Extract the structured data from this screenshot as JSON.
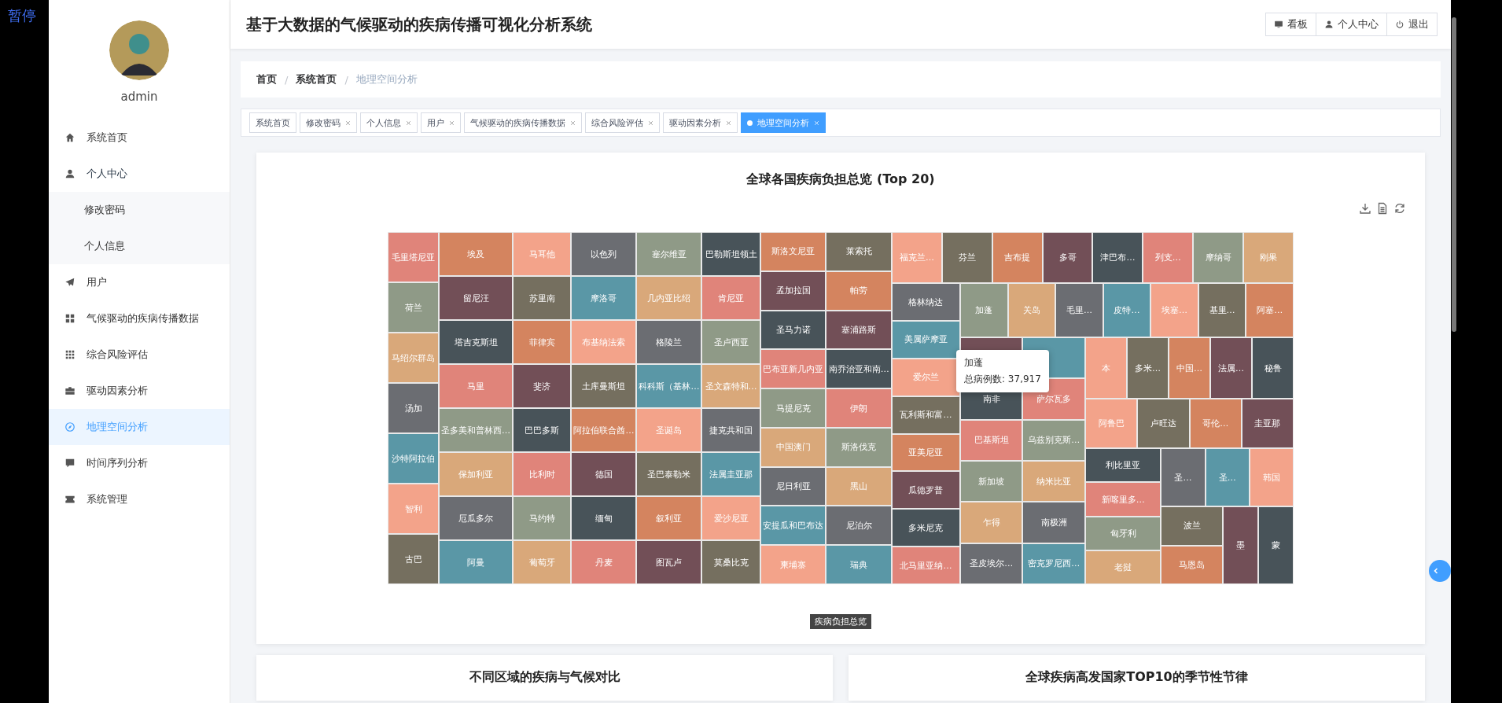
{
  "overlay": {
    "label": "暂停"
  },
  "sidebar": {
    "user": {
      "name": "admin"
    },
    "items": [
      {
        "label": "系统首页",
        "selected": false
      },
      {
        "label": "个人中心",
        "selected": false,
        "expanded": true,
        "children": [
          {
            "label": "修改密码",
            "selected": false
          },
          {
            "label": "个人信息",
            "selected": false
          }
        ]
      },
      {
        "label": "用户",
        "selected": false
      },
      {
        "label": "气候驱动的疾病传播数据",
        "selected": false
      },
      {
        "label": "综合风险评估",
        "selected": false
      },
      {
        "label": "驱动因素分析",
        "selected": false
      },
      {
        "label": "地理空间分析",
        "selected": true
      },
      {
        "label": "时间序列分析",
        "selected": false
      },
      {
        "label": "系统管理",
        "selected": false
      }
    ]
  },
  "header": {
    "title": "基于大数据的气候驱动的疾病传播可视化分析系统",
    "buttons": [
      {
        "label": "看板"
      },
      {
        "label": "个人中心"
      },
      {
        "label": "退出"
      }
    ]
  },
  "breadcrumb": {
    "separator": "/",
    "items": [
      {
        "label": "首页",
        "current": false
      },
      {
        "label": "系统首页",
        "current": false
      },
      {
        "label": "地理空间分析",
        "current": true
      }
    ]
  },
  "tabs": [
    {
      "label": "系统首页",
      "closable": false,
      "selected": false
    },
    {
      "label": "修改密码",
      "closable": true,
      "selected": false
    },
    {
      "label": "个人信息",
      "closable": true,
      "selected": false
    },
    {
      "label": "用户",
      "closable": true,
      "selected": false
    },
    {
      "label": "气候驱动的疾病传播数据",
      "closable": true,
      "selected": false
    },
    {
      "label": "综合风险评估",
      "closable": true,
      "selected": false
    },
    {
      "label": "驱动因素分析",
      "closable": true,
      "selected": false
    },
    {
      "label": "地理空间分析",
      "closable": true,
      "selected": true
    }
  ],
  "chart_card": {
    "title": "全球各国疾病负担总览 (Top 20)",
    "legend": "疾病负担总览",
    "tooltip": {
      "name": "加蓬",
      "text": "总病例数: 37,917"
    },
    "treemap": {
      "kind": "row",
      "children": [
        {
          "kind": "column",
          "children": [
            {
              "kind": "tile",
              "label": "毛里塔尼亚",
              "color": "#e0847a"
            },
            {
              "kind": "tile",
              "label": "荷兰",
              "color": "#8f9a87"
            },
            {
              "kind": "tile",
              "label": "马绍尔群岛",
              "color": "#d9a87a"
            },
            {
              "kind": "tile",
              "label": "汤加",
              "color": "#6b6d72"
            },
            {
              "kind": "tile",
              "label": "沙特阿拉伯",
              "color": "#5a97a6"
            },
            {
              "kind": "tile",
              "label": "智利",
              "color": "#f3a38a"
            },
            {
              "kind": "tile",
              "label": "古巴",
              "color": "#756f5f"
            }
          ]
        },
        {
          "kind": "column",
          "children": [
            {
              "kind": "tile",
              "label": "埃及",
              "color": "#d4845f"
            },
            {
              "kind": "tile",
              "label": "留尼汪",
              "color": "#724f57"
            },
            {
              "kind": "tile",
              "label": "塔吉克斯坦",
              "color": "#485359"
            },
            {
              "kind": "tile",
              "label": "马里",
              "color": "#e0847a"
            },
            {
              "kind": "tile",
              "label": "圣多美和普林西…",
              "color": "#8f9a87"
            },
            {
              "kind": "tile",
              "label": "保加利亚",
              "color": "#d9a87a"
            },
            {
              "kind": "tile",
              "label": "厄瓜多尔",
              "color": "#6b6d72"
            },
            {
              "kind": "tile",
              "label": "阿曼",
              "color": "#5a97a6"
            }
          ]
        },
        {
          "kind": "column",
          "children": [
            {
              "kind": "tile",
              "label": "马耳他",
              "color": "#f3a38a"
            },
            {
              "kind": "tile",
              "label": "苏里南",
              "color": "#756f5f"
            },
            {
              "kind": "tile",
              "label": "菲律宾",
              "color": "#d4845f"
            },
            {
              "kind": "tile",
              "label": "斐济",
              "color": "#724f57"
            },
            {
              "kind": "tile",
              "label": "巴巴多斯",
              "color": "#485359"
            },
            {
              "kind": "tile",
              "label": "比利时",
              "color": "#e0847a"
            },
            {
              "kind": "tile",
              "label": "马约特",
              "color": "#8f9a87"
            },
            {
              "kind": "tile",
              "label": "葡萄牙",
              "color": "#d9a87a"
            }
          ]
        },
        {
          "kind": "column",
          "children": [
            {
              "kind": "tile",
              "label": "以色列",
              "color": "#6b6d72"
            },
            {
              "kind": "tile",
              "label": "摩洛哥",
              "color": "#5a97a6"
            },
            {
              "kind": "tile",
              "label": "布基纳法索",
              "color": "#f3a38a"
            },
            {
              "kind": "tile",
              "label": "土库曼斯坦",
              "color": "#756f5f"
            },
            {
              "kind": "tile",
              "label": "阿拉伯联合酋…",
              "color": "#d4845f"
            },
            {
              "kind": "tile",
              "label": "德国",
              "color": "#724f57"
            },
            {
              "kind": "tile",
              "label": "缅甸",
              "color": "#485359"
            },
            {
              "kind": "tile",
              "label": "丹麦",
              "color": "#e0847a"
            }
          ]
        },
        {
          "kind": "column",
          "children": [
            {
              "kind": "tile",
              "label": "塞尔维亚",
              "color": "#8f9a87"
            },
            {
              "kind": "tile",
              "label": "几内亚比绍",
              "color": "#d9a87a"
            },
            {
              "kind": "tile",
              "label": "格陵兰",
              "color": "#6b6d72"
            },
            {
              "kind": "tile",
              "label": "科科斯（基林…",
              "color": "#5a97a6"
            },
            {
              "kind": "tile",
              "label": "圣诞岛",
              "color": "#f3a38a"
            },
            {
              "kind": "tile",
              "label": "圣巴泰勒米",
              "color": "#756f5f"
            },
            {
              "kind": "tile",
              "label": "叙利亚",
              "color": "#d4845f"
            },
            {
              "kind": "tile",
              "label": "图瓦卢",
              "color": "#724f57"
            }
          ]
        },
        {
          "kind": "column",
          "children": [
            {
              "kind": "tile",
              "label": "巴勒斯坦领土",
              "color": "#485359"
            },
            {
              "kind": "tile",
              "label": "肯尼亚",
              "color": "#e0847a"
            },
            {
              "kind": "tile",
              "label": "圣卢西亚",
              "color": "#8f9a87"
            },
            {
              "kind": "tile",
              "label": "圣文森特和…",
              "color": "#d9a87a"
            },
            {
              "kind": "tile",
              "label": "捷克共和国",
              "color": "#6b6d72"
            },
            {
              "kind": "tile",
              "label": "法属圭亚那",
              "color": "#5a97a6"
            },
            {
              "kind": "tile",
              "label": "爱沙尼亚",
              "color": "#f3a38a"
            },
            {
              "kind": "tile",
              "label": "莫桑比克",
              "color": "#756f5f"
            }
          ]
        },
        {
          "kind": "column",
          "children": [
            {
              "kind": "tile",
              "label": "斯洛文尼亚",
              "color": "#d4845f"
            },
            {
              "kind": "tile",
              "label": "孟加拉国",
              "color": "#724f57"
            },
            {
              "kind": "tile",
              "label": "圣马力诺",
              "color": "#485359"
            },
            {
              "kind": "tile",
              "label": "巴布亚新几内亚",
              "color": "#e0847a"
            },
            {
              "kind": "tile",
              "label": "马提尼克",
              "color": "#8f9a87"
            },
            {
              "kind": "tile",
              "label": "中国澳门",
              "color": "#d9a87a"
            },
            {
              "kind": "tile",
              "label": "尼日利亚",
              "color": "#6b6d72"
            },
            {
              "kind": "tile",
              "label": "安提瓜和巴布达",
              "color": "#5a97a6"
            },
            {
              "kind": "tile",
              "label": "柬埔寨",
              "color": "#f3a38a"
            }
          ]
        },
        {
          "kind": "column",
          "children": [
            {
              "kind": "tile",
              "label": "莱索托",
              "color": "#756f5f"
            },
            {
              "kind": "tile",
              "label": "帕劳",
              "color": "#d4845f"
            },
            {
              "kind": "tile",
              "label": "塞浦路斯",
              "color": "#724f57"
            },
            {
              "kind": "tile",
              "label": "南乔治亚和南…",
              "color": "#485359"
            },
            {
              "kind": "tile",
              "label": "伊朗",
              "color": "#e0847a"
            },
            {
              "kind": "tile",
              "label": "斯洛伐克",
              "color": "#8f9a87"
            },
            {
              "kind": "tile",
              "label": "黑山",
              "color": "#d9a87a"
            },
            {
              "kind": "tile",
              "label": "尼泊尔",
              "color": "#6b6d72"
            },
            {
              "kind": "tile",
              "label": "瑞典",
              "color": "#5a97a6"
            }
          ]
        },
        {
          "kind": "column",
          "children": [
            {
              "kind": "row",
              "children": [
                {
                  "kind": "tile",
                  "label": "福克兰…",
                  "color": "#f3a38a"
                },
                {
                  "kind": "tile",
                  "label": "芬兰",
                  "color": "#756f5f"
                },
                {
                  "kind": "tile",
                  "label": "吉布提",
                  "color": "#d4845f"
                },
                {
                  "kind": "tile",
                  "label": "多哥",
                  "color": "#724f57"
                },
                {
                  "kind": "tile",
                  "label": "津巴布…",
                  "color": "#485359"
                },
                {
                  "kind": "tile",
                  "label": "列支…",
                  "color": "#e0847a"
                },
                {
                  "kind": "tile",
                  "label": "摩纳哥",
                  "color": "#8f9a87"
                },
                {
                  "kind": "tile",
                  "label": "刚果",
                  "color": "#d9a87a"
                }
              ]
            },
            {
              "kind": "row",
              "children": [
                {
                  "kind": "column",
                  "children": [
                    {
                      "kind": "tile",
                      "label": "格林纳达",
                      "color": "#6b6d72"
                    },
                    {
                      "kind": "tile",
                      "label": "美属萨摩亚",
                      "color": "#5a97a6"
                    },
                    {
                      "kind": "tile",
                      "label": "爱尔兰",
                      "color": "#f3a38a"
                    },
                    {
                      "kind": "tile",
                      "label": "瓦利斯和富…",
                      "color": "#756f5f"
                    },
                    {
                      "kind": "tile",
                      "label": "亚美尼亚",
                      "color": "#d4845f"
                    },
                    {
                      "kind": "tile",
                      "label": "瓜德罗普",
                      "color": "#724f57"
                    },
                    {
                      "kind": "tile",
                      "label": "多米尼克",
                      "color": "#485359"
                    },
                    {
                      "kind": "tile",
                      "label": "北马里亚纳…",
                      "color": "#e0847a"
                    }
                  ]
                },
                {
                  "kind": "column",
                  "children": [
                    {
                      "kind": "row",
                      "children": [
                        {
                          "kind": "tile",
                          "label": "加蓬",
                          "color": "#8f9a87"
                        },
                        {
                          "kind": "tile",
                          "label": "关岛",
                          "color": "#d9a87a"
                        },
                        {
                          "kind": "tile",
                          "label": "毛里…",
                          "color": "#6b6d72"
                        },
                        {
                          "kind": "tile",
                          "label": "皮特…",
                          "color": "#5a97a6"
                        },
                        {
                          "kind": "tile",
                          "label": "埃塞…",
                          "color": "#f3a38a"
                        },
                        {
                          "kind": "tile",
                          "label": "基里…",
                          "color": "#756f5f"
                        },
                        {
                          "kind": "tile",
                          "label": "阿塞…",
                          "color": "#d4845f"
                        }
                      ]
                    },
                    {
                      "kind": "row",
                      "children": [
                        {
                          "kind": "column",
                          "children": [
                            {
                              "kind": "tile",
                              "color": "#724f57"
                            },
                            {
                              "kind": "tile",
                              "label": "南非",
                              "color": "#485359"
                            },
                            {
                              "kind": "tile",
                              "label": "巴基斯坦",
                              "color": "#e0847a"
                            },
                            {
                              "kind": "tile",
                              "label": "新加坡",
                              "color": "#8f9a87"
                            },
                            {
                              "kind": "tile",
                              "label": "乍得",
                              "color": "#d9a87a"
                            },
                            {
                              "kind": "tile",
                              "label": "圣皮埃尔…",
                              "color": "#6b6d72"
                            }
                          ]
                        },
                        {
                          "kind": "column",
                          "children": [
                            {
                              "kind": "tile",
                              "color": "#5a97a6"
                            },
                            {
                              "kind": "tile",
                              "label": "萨尔瓦多",
                              "color": "#e0847a"
                            },
                            {
                              "kind": "tile",
                              "label": "乌兹别克斯…",
                              "color": "#8f9a87"
                            },
                            {
                              "kind": "tile",
                              "label": "纳米比亚",
                              "color": "#d9a87a"
                            },
                            {
                              "kind": "tile",
                              "label": "南极洲",
                              "color": "#6b6d72"
                            },
                            {
                              "kind": "tile",
                              "label": "密克罗尼西…",
                              "color": "#5a97a6"
                            }
                          ]
                        },
                        {
                          "kind": "column",
                          "children": [
                            {
                              "kind": "row",
                              "children": [
                                {
                                  "kind": "tile",
                                  "label": "本",
                                  "color": "#f3a38a"
                                },
                                {
                                  "kind": "tile",
                                  "label": "多米…",
                                  "color": "#756f5f"
                                },
                                {
                                  "kind": "tile",
                                  "label": "中国…",
                                  "color": "#d4845f"
                                },
                                {
                                  "kind": "tile",
                                  "label": "法属…",
                                  "color": "#724f57"
                                },
                                {
                                  "kind": "tile",
                                  "label": "秘鲁",
                                  "color": "#485359"
                                }
                              ]
                            },
                            {
                              "kind": "row",
                              "children": [
                                {
                                  "kind": "tile",
                                  "label": "阿鲁巴",
                                  "color": "#f3a38a"
                                },
                                {
                                  "kind": "tile",
                                  "label": "卢旺达",
                                  "color": "#756f5f"
                                },
                                {
                                  "kind": "tile",
                                  "label": "哥伦…",
                                  "color": "#d4845f"
                                },
                                {
                                  "kind": "tile",
                                  "label": "圭亚那",
                                  "color": "#724f57"
                                }
                              ]
                            },
                            {
                              "kind": "row",
                              "children": [
                                {
                                  "kind": "column",
                                  "children": [
                                    {
                                      "kind": "tile",
                                      "label": "利比里亚",
                                      "color": "#485359"
                                    },
                                    {
                                      "kind": "tile",
                                      "label": "新喀里多…",
                                      "color": "#e0847a"
                                    },
                                    {
                                      "kind": "tile",
                                      "label": "匈牙利",
                                      "color": "#8f9a87"
                                    },
                                    {
                                      "kind": "tile",
                                      "label": "老挝",
                                      "color": "#d9a87a"
                                    }
                                  ]
                                },
                                {
                                  "kind": "column",
                                  "children": [
                                    {
                                      "kind": "row",
                                      "children": [
                                        {
                                          "kind": "tile",
                                          "label": "圣…",
                                          "color": "#6b6d72"
                                        },
                                        {
                                          "kind": "tile",
                                          "label": "圣…",
                                          "color": "#5a97a6"
                                        },
                                        {
                                          "kind": "tile",
                                          "label": "韩国",
                                          "color": "#f3a38a"
                                        }
                                      ]
                                    },
                                    {
                                      "kind": "row",
                                      "children": [
                                        {
                                          "kind": "column",
                                          "children": [
                                            {
                                              "kind": "tile",
                                              "label": "波兰",
                                              "color": "#756f5f"
                                            },
                                            {
                                              "kind": "tile",
                                              "label": "马恩岛",
                                              "color": "#d4845f"
                                            }
                                          ]
                                        },
                                        {
                                          "kind": "tile",
                                          "label": "墨",
                                          "color": "#724f57"
                                        },
                                        {
                                          "kind": "tile",
                                          "label": "蒙",
                                          "color": "#485359"
                                        }
                                      ]
                                    }
                                  ]
                                }
                              ]
                            }
                          ]
                        }
                      ]
                    }
                  ]
                }
              ]
            }
          ]
        }
      ]
    }
  },
  "lower_cards": [
    {
      "title": "不同区域的疾病与气候对比"
    },
    {
      "title": "全球疾病高发国家TOP10的季节性节律"
    }
  ]
}
